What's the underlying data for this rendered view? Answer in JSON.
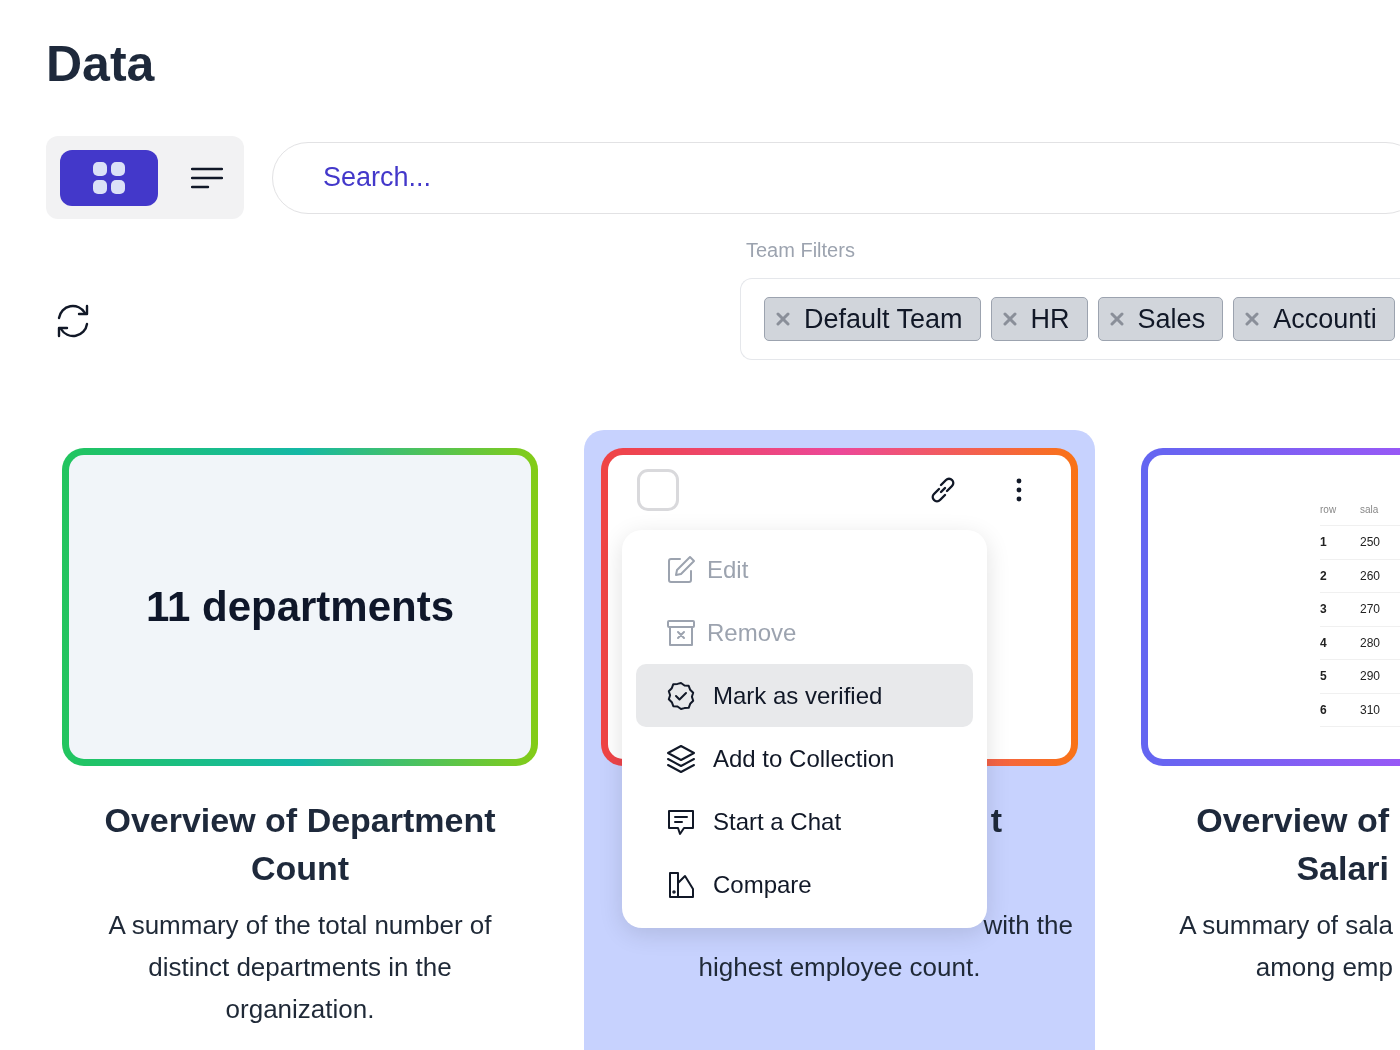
{
  "page_title": "Data",
  "view_toggle": [
    {
      "kind": "grid",
      "selected": true
    },
    {
      "kind": "list",
      "selected": false
    }
  ],
  "search": {
    "placeholder": "Search..."
  },
  "team_filters": {
    "label": "Team Filters",
    "chips": [
      "Default Team",
      "HR",
      "Sales",
      "Accounti"
    ]
  },
  "cards": [
    {
      "kind": "stat",
      "highlighted": false,
      "preview": {
        "value": "11 departments"
      },
      "title": "Overview of Department Count",
      "description": "A summary of the total number of distinct departments in the organization."
    },
    {
      "kind": "actions",
      "highlighted": true,
      "checked": false,
      "title": "t",
      "description_lines": [
        "with the",
        "highest employee count."
      ],
      "menu": [
        {
          "label": "Edit",
          "disabled": true,
          "selected": false
        },
        {
          "label": "Remove",
          "disabled": true,
          "selected": false
        },
        {
          "label": "Mark as verified",
          "disabled": false,
          "selected": true
        },
        {
          "label": "Add to Collection",
          "disabled": false,
          "selected": false
        },
        {
          "label": "Start a Chat",
          "disabled": false,
          "selected": false
        },
        {
          "label": "Compare",
          "disabled": false,
          "selected": false
        }
      ]
    },
    {
      "kind": "table",
      "highlighted": false,
      "preview": {
        "columns": [
          "row",
          "sala"
        ],
        "rows": [
          [
            "1",
            "250"
          ],
          [
            "2",
            "260"
          ],
          [
            "3",
            "270"
          ],
          [
            "4",
            "280"
          ],
          [
            "5",
            "290"
          ],
          [
            "6",
            "310"
          ]
        ]
      },
      "title": "Overview of Salari",
      "description": "A summary of sala among emp"
    }
  ]
}
